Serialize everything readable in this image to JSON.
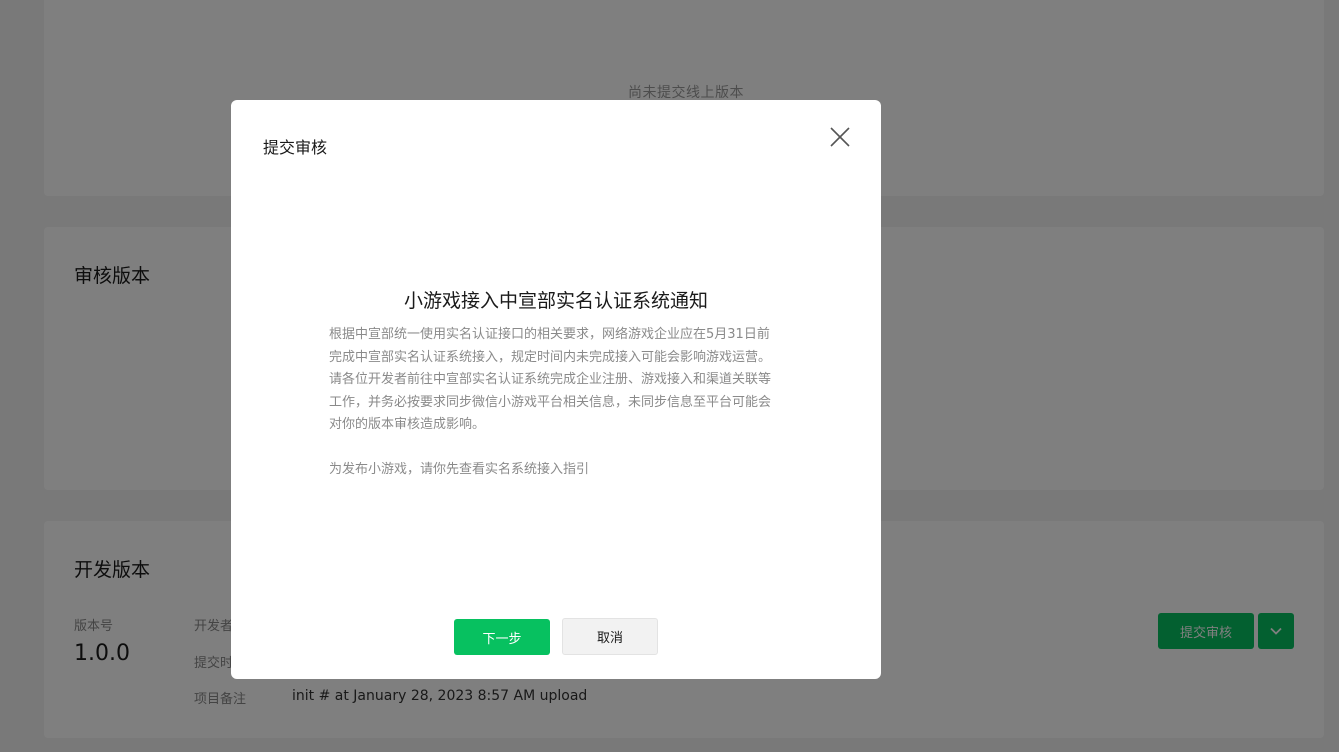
{
  "online": {
    "empty_text": "尚未提交线上版本"
  },
  "review": {
    "title": "审核版本"
  },
  "dev": {
    "title": "开发版本",
    "version_label": "版本号",
    "version_value": "1.0.0",
    "developer_label": "开发者",
    "submit_time_label": "提交时间",
    "note_label": "项目备注",
    "note_value": "init # at January 28, 2023 8:57 AM upload",
    "submit_button": "提交审核"
  },
  "modal": {
    "title": "提交审核",
    "notice_heading": "小游戏接入中宣部实名认证系统通知",
    "paragraph1": "根据中宣部统一使用实名认证接口的相关要求，网络游戏企业应在5月31日前完成中宣部实名认证系统接入，规定时间内未完成接入可能会影响游戏运营。",
    "paragraph2": "请各位开发者前往中宣部实名认证系统完成企业注册、游戏接入和渠道关联等工作，并务必按要求同步微信小游戏平台相关信息，未同步信息至平台可能会对你的版本审核造成影响。",
    "paragraph3": "为发布小游戏，请你先查看实名系统接入指引",
    "next_button": "下一步",
    "cancel_button": "取消"
  },
  "colors": {
    "brand_green": "#07c160",
    "overlay": "rgba(0,0,0,0.5)"
  },
  "icons": [
    "close-icon",
    "chevron-down-icon"
  ]
}
